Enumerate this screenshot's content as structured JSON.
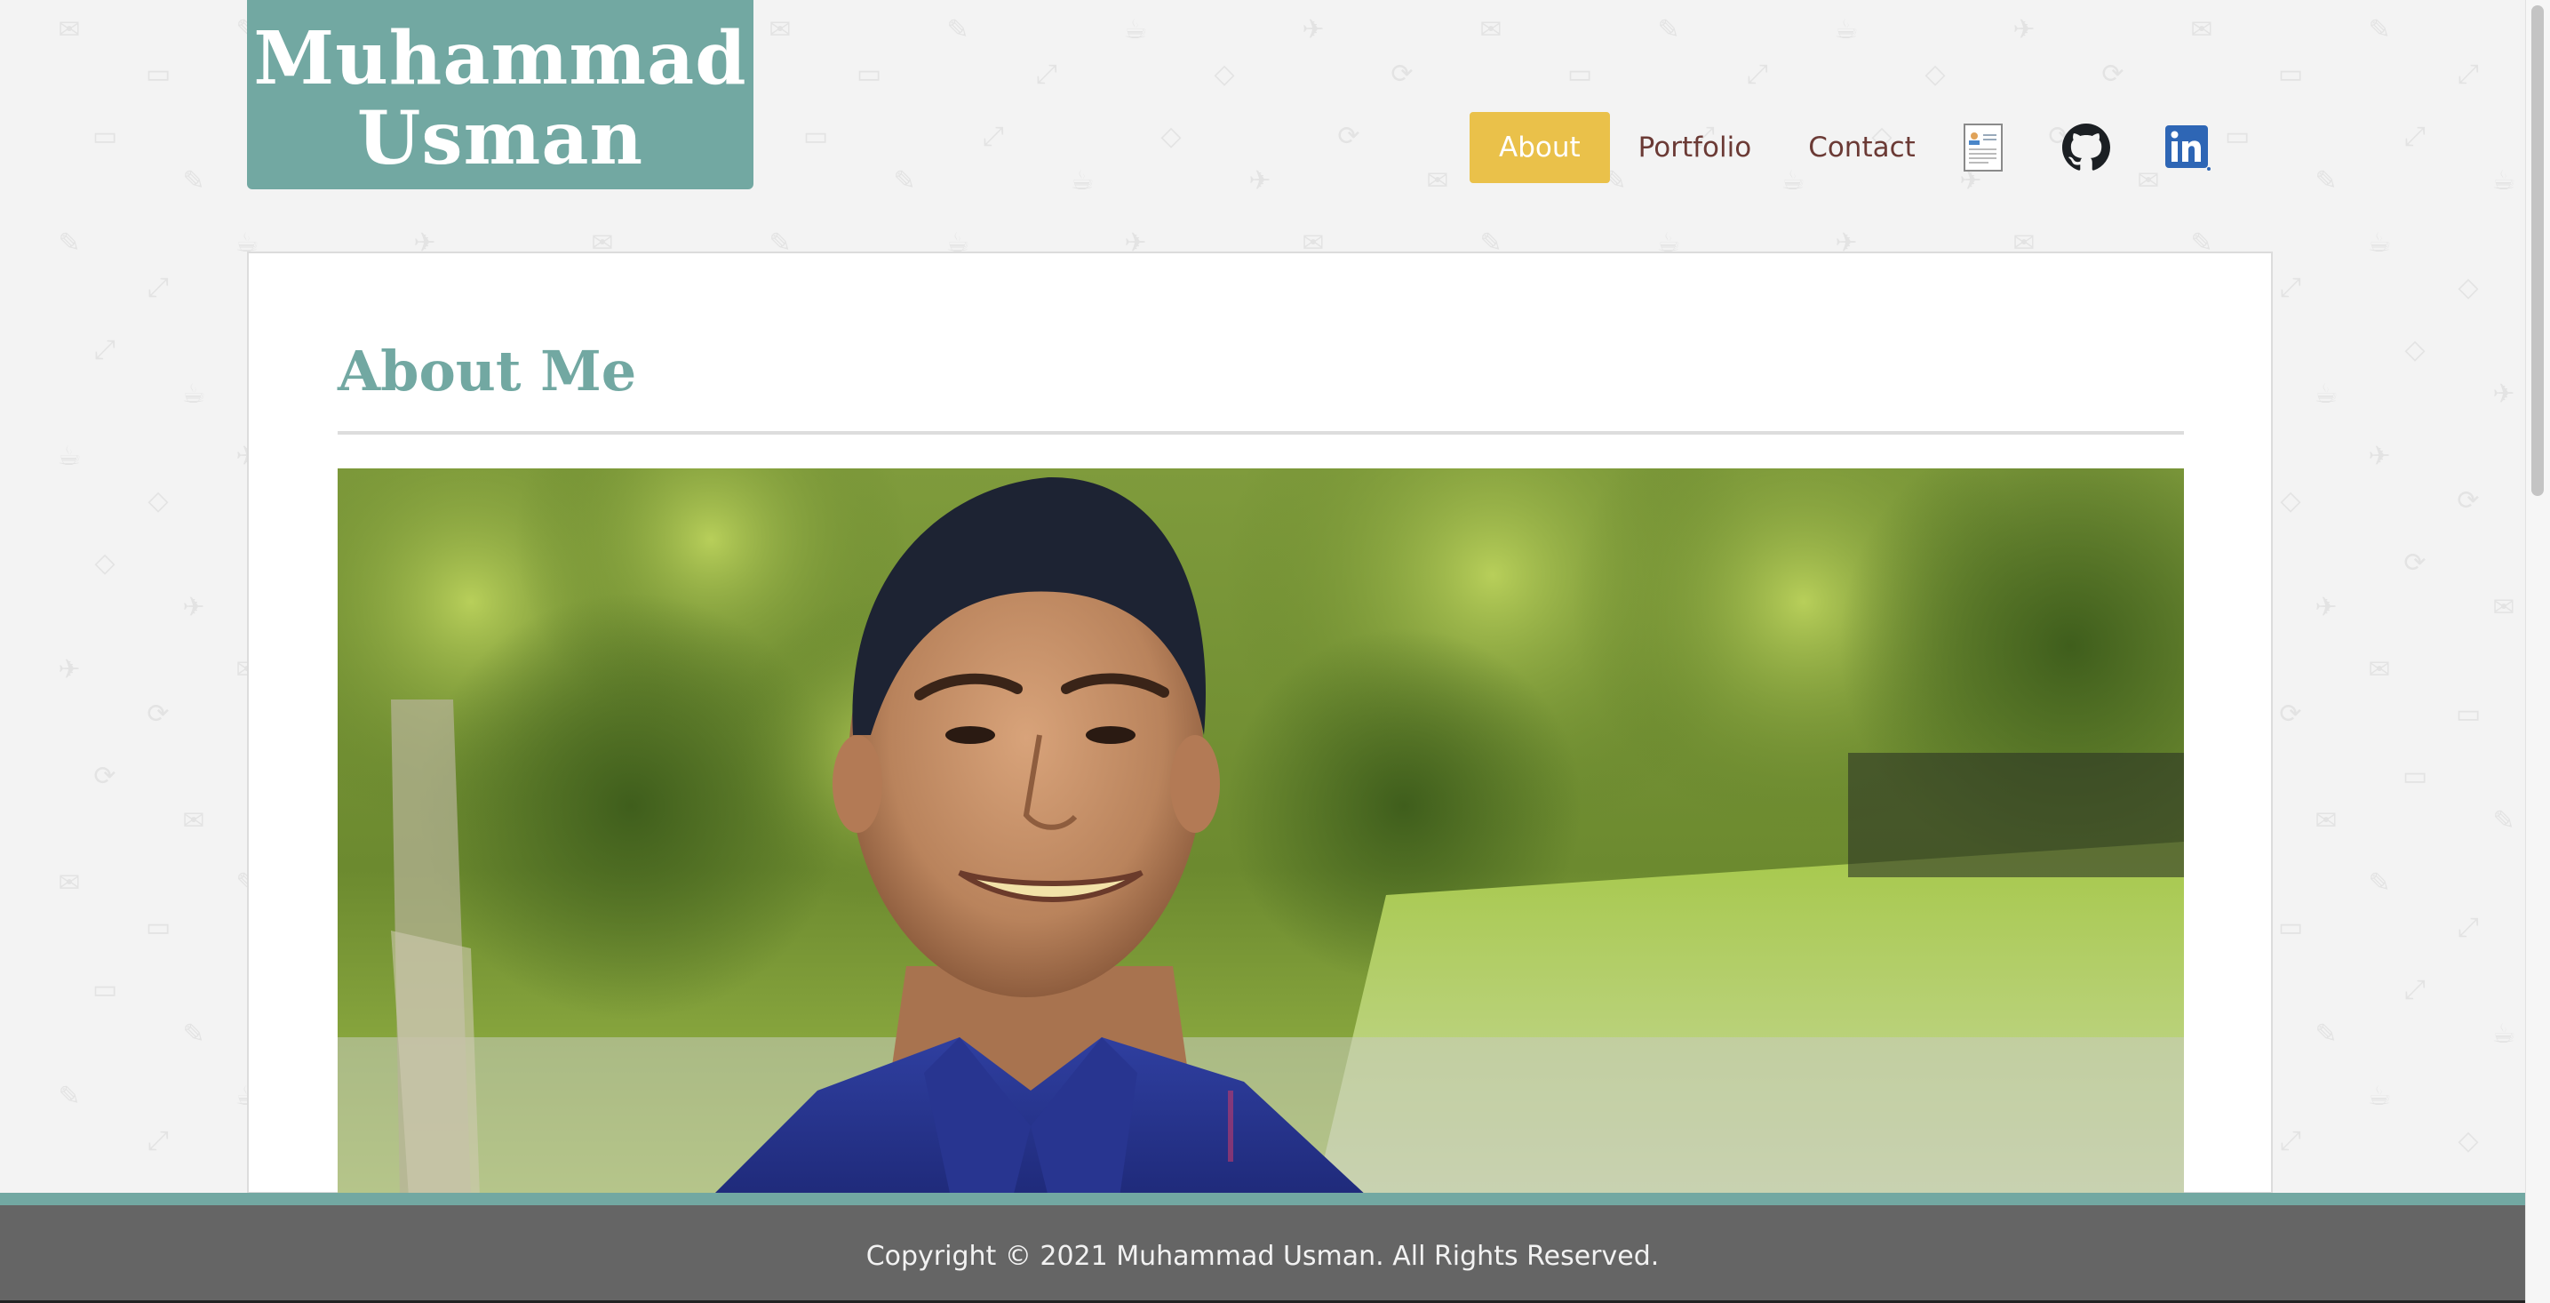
{
  "brand": {
    "line1": "Muhammad",
    "line2": "Usman",
    "color": "#72a8a2"
  },
  "nav": {
    "items": [
      {
        "label": "About",
        "active": true
      },
      {
        "label": "Portfolio",
        "active": false
      },
      {
        "label": "Contact",
        "active": false
      }
    ],
    "icons": [
      "resume-icon",
      "github-icon",
      "linkedin-icon"
    ],
    "active_color": "#eac14a",
    "link_color": "#6b3a35"
  },
  "main": {
    "title": "About Me",
    "title_color": "#72a8a2",
    "portrait": "photo of smiling man in navy shirt in front of green trees"
  },
  "footer": {
    "text": "Copyright © 2021 Muhammad Usman. All Rights Reserved.",
    "accent_color": "#72a8a2"
  }
}
